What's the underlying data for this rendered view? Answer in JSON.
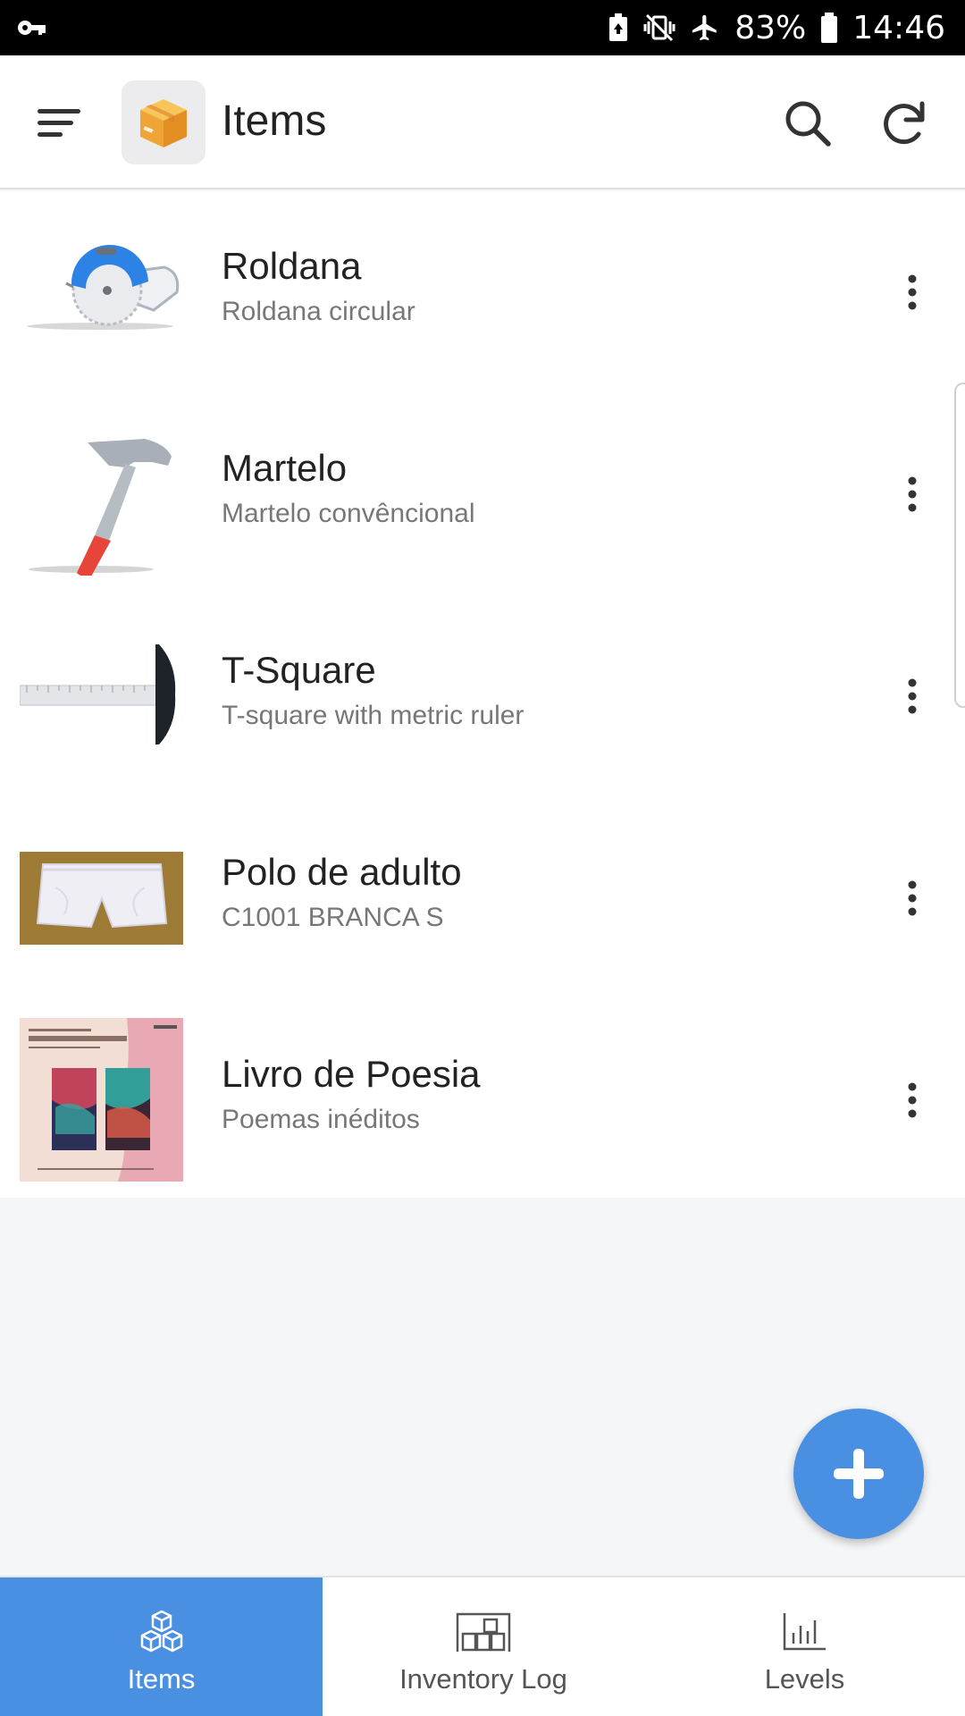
{
  "status_bar": {
    "battery_percent": "83%",
    "time": "14:46",
    "icons": [
      "key-icon",
      "battery-saver-icon",
      "vibrate-icon",
      "airplane-icon",
      "battery-icon"
    ]
  },
  "app_bar": {
    "title": "Items",
    "icons": [
      "menu-icon",
      "box-logo-icon",
      "search-icon",
      "refresh-icon"
    ]
  },
  "items": [
    {
      "name": "Roldana",
      "description": "Roldana circular",
      "thumbnail": "circular-saw-image"
    },
    {
      "name": "Martelo",
      "description": "Martelo convêncional",
      "thumbnail": "hammer-image"
    },
    {
      "name": "T-Square",
      "description": "T-square with metric ruler",
      "thumbnail": "t-square-image"
    },
    {
      "name": "Polo de adulto",
      "description": "C1001 BRANCA S",
      "thumbnail": "white-shorts-photo"
    },
    {
      "name": "Livro de Poesia",
      "description": "Poemas inéditos",
      "thumbnail": "book-cover-image"
    }
  ],
  "fab": {
    "icon": "plus-icon"
  },
  "bottom_nav": {
    "active": "Items",
    "tabs": [
      {
        "label": "Items",
        "icon": "cubes-icon"
      },
      {
        "label": "Inventory Log",
        "icon": "warehouse-icon"
      },
      {
        "label": "Levels",
        "icon": "bar-chart-icon"
      }
    ]
  },
  "colors": {
    "accent": "#4a90e2",
    "status_bar_bg": "#000000",
    "background": "#f5f6f8",
    "text_primary": "#222222",
    "text_secondary": "#777777"
  }
}
